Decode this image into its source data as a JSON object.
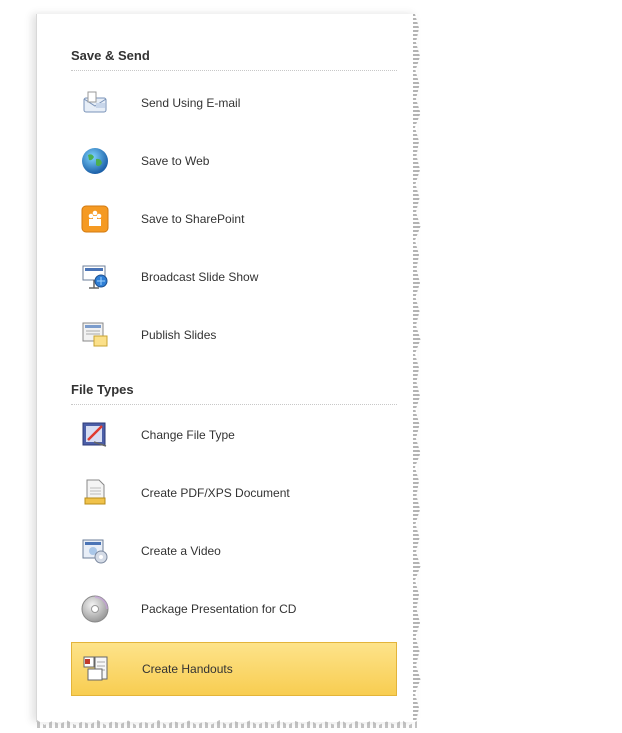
{
  "sections": [
    {
      "title": "Save & Send",
      "items": [
        {
          "label": "Send Using E-mail",
          "icon": "email-icon"
        },
        {
          "label": "Save to Web",
          "icon": "globe-icon"
        },
        {
          "label": "Save to SharePoint",
          "icon": "sharepoint-icon"
        },
        {
          "label": "Broadcast Slide Show",
          "icon": "broadcast-icon"
        },
        {
          "label": "Publish Slides",
          "icon": "publish-slides-icon"
        }
      ]
    },
    {
      "title": "File Types",
      "items": [
        {
          "label": "Change File Type",
          "icon": "change-file-type-icon"
        },
        {
          "label": "Create PDF/XPS Document",
          "icon": "pdf-document-icon"
        },
        {
          "label": "Create a Video",
          "icon": "video-icon"
        },
        {
          "label": "Package Presentation for CD",
          "icon": "cd-icon"
        },
        {
          "label": "Create Handouts",
          "icon": "handouts-icon",
          "selected": true
        }
      ]
    }
  ],
  "colors": {
    "selected_bg": "#f8cd51",
    "selected_border": "#e3b43a"
  }
}
